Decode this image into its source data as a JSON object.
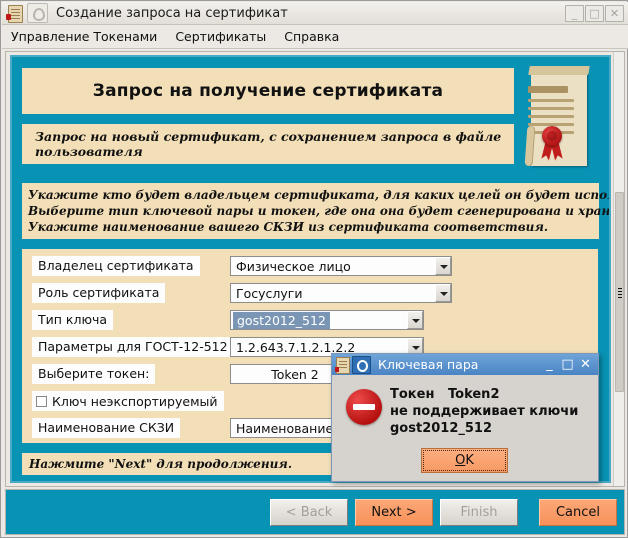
{
  "window": {
    "title": "Создание запроса на сертификат",
    "icon": "certificate-icon",
    "controls": {
      "minimize": "_",
      "maximize": "□",
      "close": "✕"
    }
  },
  "menubar": {
    "items": [
      {
        "label": "Управление Токенами"
      },
      {
        "label": "Сертификаты"
      },
      {
        "label": "Справка"
      }
    ]
  },
  "wizard": {
    "header_title": "Запрос на получение сертификата",
    "header_subtitle": "Запрос на новый сертификат, с сохранением запроса в файле пользователя",
    "instructions": [
      "Укажите кто будет владельцем сертификата, для каких целей он будет использоваться.",
      "Выберите тип ключевой пары и токен, где она она будет сгенерирована и хранится.",
      "Укажите наименование вашего СКЗИ из сертификата соответствия."
    ],
    "hint": "Нажмите \"Next\" для продолжения.",
    "fields": [
      {
        "label": "Владелец сертификата",
        "value": "Физическое лицо",
        "type": "combo"
      },
      {
        "label": "Роль сертификата",
        "value": "Госуслуги",
        "type": "combo"
      },
      {
        "label": "Тип ключа",
        "value": "gost2012_512",
        "type": "combo-selected"
      },
      {
        "label": "Параметры для ГОСТ-12-512",
        "value": "1.2.643.7.1.2.1.2.2",
        "type": "combo"
      },
      {
        "label": "Выберите токен:",
        "value": "Token 2",
        "type": "text-center"
      },
      {
        "label": "Ключ неэкспортируемый",
        "value": "",
        "type": "checkbox",
        "checked": false
      },
      {
        "label": "Наименование СКЗИ",
        "value": "Наименование С",
        "type": "text"
      }
    ]
  },
  "buttons": {
    "back": {
      "label": "< Back",
      "enabled": false
    },
    "next": {
      "label": "Next >",
      "enabled": true
    },
    "finish": {
      "label": "Finish",
      "enabled": false
    },
    "cancel": {
      "label": "Cancel",
      "enabled": true
    }
  },
  "dialog": {
    "title": "Ключевая пара",
    "icon": "error-stop-icon",
    "message": "Токен   Token2\nне поддерживает ключи\ngost2012_512",
    "ok_prefix": "",
    "ok_accel": "O",
    "ok_suffix": "K",
    "controls": {
      "minimize": "_",
      "maximize": "□",
      "close": "✕"
    }
  },
  "colors": {
    "teal": "#0892b4",
    "beige": "#f2dfb8",
    "orange": "#f8915a",
    "error_red": "#b50f0f",
    "dialog_titlebar": "#4a84c4",
    "selection": "#7a96b4"
  }
}
